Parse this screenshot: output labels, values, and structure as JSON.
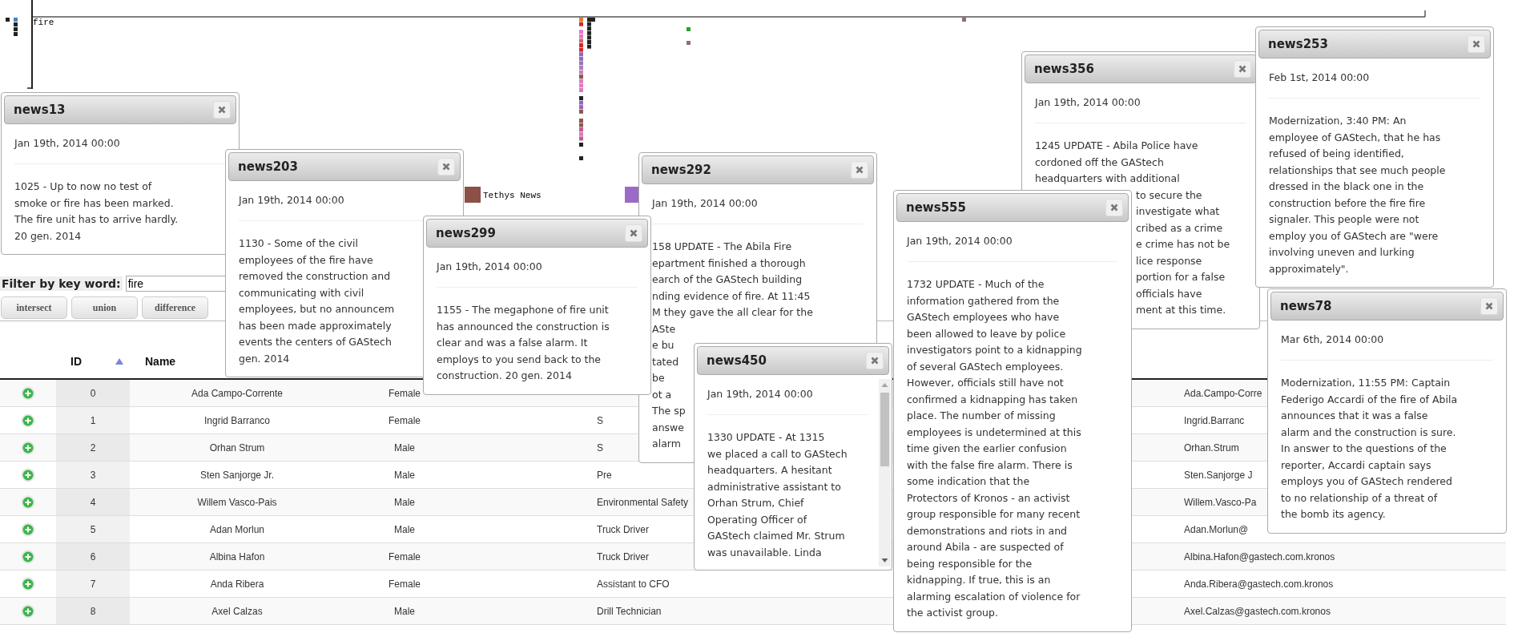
{
  "timeline": {
    "keyword": "fire",
    "legend": [
      {
        "label": "Tethys News",
        "color": "#8b5146"
      },
      {
        "color": "#9b6ac6"
      }
    ]
  },
  "filter": {
    "label": "Filter by key word:",
    "value": "fire"
  },
  "set_buttons": [
    "intersect",
    "union",
    "difference"
  ],
  "table": {
    "columns": [
      {
        "label": "ID",
        "sorted": true
      },
      {
        "label": "Name",
        "sorted": false
      }
    ],
    "rows": [
      {
        "id": "0",
        "name": "Ada Campo-Corrente",
        "gender": "Female",
        "email": "Ada.Campo-Corre"
      },
      {
        "id": "1",
        "name": "Ingrid Barranco",
        "gender": "Female",
        "job": "S",
        "email": "Ingrid.Barranc"
      },
      {
        "id": "2",
        "name": "Orhan Strum",
        "gender": "Male",
        "job": "S",
        "email": "Orhan.Strum"
      },
      {
        "id": "3",
        "name": "Sten Sanjorge Jr.",
        "gender": "Male",
        "job": "Pre",
        "email": "Sten.Sanjorge J"
      },
      {
        "id": "4",
        "name": "Willem Vasco-Pais",
        "gender": "Male",
        "job": "Environmental Safety",
        "email": "Willem.Vasco-Pa"
      },
      {
        "id": "5",
        "name": "Adan Morlun",
        "gender": "Male",
        "job": "Truck Driver",
        "email": "Adan.Morlun@"
      },
      {
        "id": "6",
        "name": "Albina Hafon",
        "gender": "Female",
        "job": "Truck Driver",
        "email": "Albina.Hafon@gastech.com.kronos"
      },
      {
        "id": "7",
        "name": "Anda Ribera",
        "gender": "Female",
        "job": "Assistant to CFO",
        "email": "Anda.Ribera@gastech.com.kronos"
      },
      {
        "id": "8",
        "name": "Axel Calzas",
        "gender": "Male",
        "job": "Drill Technician",
        "email": "Axel.Calzas@gastech.com.kronos"
      }
    ]
  },
  "news_windows": [
    {
      "title": "news13",
      "date": "Jan 19th, 2014 00:00",
      "blocks": [
        {
          "kind": "text",
          "lines": [
            "1025 - Up to now no test of",
            "smoke or fire has been marked.",
            "The fire unit has to arrive hardly.",
            "20 gen. 2014"
          ]
        }
      ]
    },
    {
      "title": "news203",
      "date": "Jan 19th, 2014 00:00",
      "blocks": [
        {
          "kind": "text",
          "lines": [
            "1130 - Some of the civil",
            "employees of the fire have",
            "removed the construction and",
            "communicating with civil",
            "employees, but no announcem",
            "has been made approximately",
            "events the centers of GAStech",
            "gen. 2014"
          ]
        }
      ]
    },
    {
      "title": "news299",
      "date": "Jan 19th, 2014 00:00",
      "blocks": [
        {
          "kind": "text",
          "lines": [
            "1155 - The megaphone of fire unit",
            "has announced the construction is",
            "clear and was a false alarm. It",
            "employs to you send back to the",
            "construction. 20 gen. 2014"
          ]
        }
      ]
    },
    {
      "title": "news292",
      "date": "Jan 19th, 2014 00:00",
      "blocks": [
        {
          "kind": "text",
          "lines": [
            "158 UPDATE - The Abila Fire",
            "epartment finished a thorough",
            "earch of the GAStech building",
            "nding evidence of fire. At 11:45",
            "M they gave the all clear for the"
          ]
        },
        {
          "kind": "text",
          "lines": [
            "ASte",
            "e bu",
            "tated",
            "be",
            "ot a",
            "The sp",
            "answe",
            "alarm"
          ]
        }
      ]
    },
    {
      "title": "news450",
      "date": "Jan 19th, 2014 00:00",
      "scrollbar": true,
      "blocks": [
        {
          "kind": "text",
          "lines": [
            "1330 UPDATE - At 1315",
            "we placed a call to GAStech",
            "headquarters. A hesitant",
            "administrative assistant to",
            "Orhan Strum, Chief",
            "Operating Officer of",
            "GAStech claimed Mr. Strum",
            "was unavailable. Linda"
          ]
        }
      ]
    },
    {
      "title": "news555",
      "date": "Jan 19th, 2014 00:00",
      "blocks": [
        {
          "kind": "text",
          "lines": [
            "1732 UPDATE - Much of the",
            "information gathered from the",
            "GAStech employees who have",
            "been allowed to leave by police",
            "investigators point to a kidnapping",
            "of several GAStech employees.",
            "However, officials still have not",
            "confirmed a kidnapping has taken",
            "place. The number of missing",
            "employees is undetermined at this",
            "time given the earlier confusion",
            "with the false fire alarm. There is",
            "some indication that the",
            "Protectors of Kronos - an activist",
            "group responsible for many recent",
            "demonstrations and riots in and",
            "around Abila - are suspected of",
            "being responsible for the",
            "kidnapping. If true, this is an",
            "alarming escalation of violence for",
            "the activist group."
          ]
        }
      ]
    },
    {
      "title": "news356",
      "date": "Jan 19th, 2014 00:00",
      "blocks": [
        {
          "kind": "text",
          "lines": [
            "1245 UPDATE - Abila Police have",
            "cordoned off the GAStech",
            "headquarters with additional"
          ]
        },
        {
          "kind": "tail",
          "lines": [
            "to secure the",
            "investigate what",
            "cribed as a crime",
            "e crime has not be",
            "lice response",
            "portion for a false",
            "officials have",
            "ment at this time."
          ]
        }
      ]
    },
    {
      "title": "news253",
      "date": "Feb 1st, 2014 00:00",
      "blocks": [
        {
          "kind": "text",
          "lines": [
            "Modernization, 3:40 PM: An",
            "employee of GAStech, that he has",
            "refused of being identified,",
            "relationships that see much people",
            "dressed in the black one in the",
            "construction before the fire fire",
            "signaler. This people were not",
            "employ you of GAStech are \"were",
            "involving uneven and lurking",
            "approximately\"."
          ]
        }
      ]
    },
    {
      "title": "news78",
      "date": "Mar 6th, 2014 00:00",
      "blocks": [
        {
          "kind": "text",
          "lines": [
            "Modernization, 11:55 PM: Captain",
            "Federigo Accardi of the fire of Abila",
            "announces that it was a false",
            "alarm and the construction is sure.",
            "In answer to the questions of the",
            "reporter, Accardi captain says",
            "employs you of GAStech rendered",
            "to no relationship of a threat of",
            "the bomb its agency."
          ]
        }
      ]
    }
  ]
}
